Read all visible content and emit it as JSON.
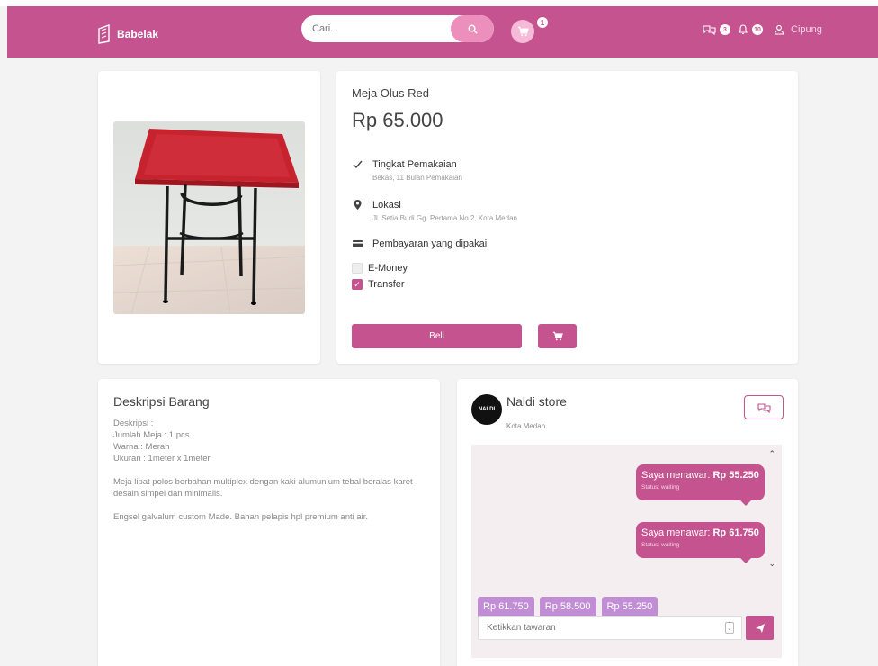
{
  "nav": {
    "brand": "Babelak",
    "search_placeholder": "Cari...",
    "cart_count": "1",
    "chat_count": "3",
    "notif_count": "10",
    "user_name": "Cipung"
  },
  "product": {
    "title": "Meja Olus Red",
    "price": "Rp 65.000",
    "condition_label": "Tingkat Pemakaian",
    "condition_value": "Bekas, 11 Bulan Pemakaian",
    "location_label": "Lokasi",
    "location_value": "Jl. Setia Budi Gg. Pertama No.2, Kota Medan",
    "payment_label": "Pembayaran yang dipakai",
    "payment_options": [
      {
        "label": "E-Money",
        "checked": false
      },
      {
        "label": "Transfer",
        "checked": true
      }
    ],
    "buy_label": "Beli"
  },
  "description": {
    "title": "Deskripsi Barang",
    "lines": [
      "Deskripsi :",
      "Jumlah Meja : 1 pcs",
      "Warna : Merah",
      "Ukuran : 1meter x 1meter"
    ],
    "paragraph1": "Meja lipat polos berbahan multiplex dengan kaki alumunium tebal beralas karet desain simpel dan minimalis.",
    "paragraph2": "Engsel galvalum custom Made. Bahan pelapis hpl premium anti air."
  },
  "seller": {
    "avatar_text": "NALDI",
    "name": "Naldi store",
    "city": "Kota Medan"
  },
  "chat": {
    "messages": [
      {
        "prefix": "Saya menawar: ",
        "amount": "Rp 55.250",
        "status": "Status: waiting"
      },
      {
        "prefix": "Saya menawar: ",
        "amount": "Rp 61.750",
        "status": "Status: waiting"
      }
    ],
    "offers": [
      "Rp 61.750",
      "Rp 58.500",
      "Rp 55.250"
    ],
    "input_placeholder": "Ketikkan tawaran"
  },
  "colors": {
    "brand": "#c4538f",
    "offer_tag": "#c18ed6",
    "chat_bg": "#f5eef1"
  },
  "icons": [
    "building-logo-icon",
    "search-icon",
    "cart-icon",
    "chat-icon",
    "bell-icon",
    "user-icon",
    "check-icon",
    "location-pin-icon",
    "credit-card-icon",
    "send-icon",
    "chevron-up-icon",
    "chevron-down-icon"
  ]
}
